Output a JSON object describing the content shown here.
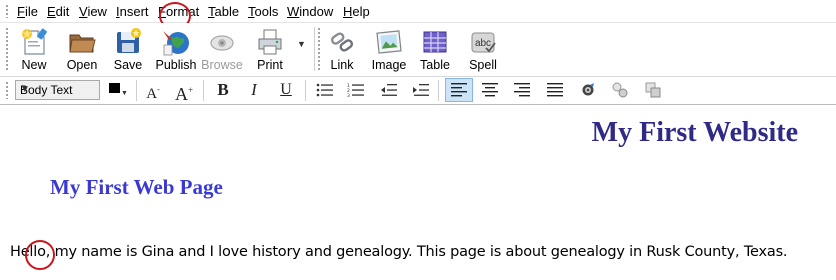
{
  "menu": {
    "items": [
      {
        "label": "File",
        "key": "F",
        "rest": "ile"
      },
      {
        "label": "Edit",
        "key": "E",
        "rest": "dit"
      },
      {
        "label": "View",
        "key": "V",
        "rest": "iew"
      },
      {
        "label": "Insert",
        "key": "I",
        "rest": "nsert"
      },
      {
        "label": "Format",
        "key": "F",
        "rest": "ormat"
      },
      {
        "label": "Table",
        "key": "T",
        "rest": "able"
      },
      {
        "label": "Tools",
        "key": "T",
        "rest": "ools"
      },
      {
        "label": "Window",
        "key": "W",
        "rest": "indow"
      },
      {
        "label": "Help",
        "key": "H",
        "rest": "elp"
      }
    ]
  },
  "toolbar": {
    "new_label": "New",
    "open_label": "Open",
    "save_label": "Save",
    "publish_label": "Publish",
    "browse_label": "Browse",
    "print_label": "Print",
    "link_label": "Link",
    "image_label": "Image",
    "table_label": "Table",
    "spell_label": "Spell"
  },
  "format": {
    "paragraph_style": "Body Text",
    "text_color": "#000000",
    "bold_glyph": "B",
    "italic_glyph": "I",
    "underline_glyph": "U",
    "active_align": "left"
  },
  "document": {
    "heading1": "My First Website",
    "heading2": "My First Web Page",
    "paragraph": "Hello, my name is Gina and I love history and genealogy. This page is about genealogy in Rusk County, Texas."
  },
  "colors": {
    "heading1": "#2f2a86",
    "heading2": "#3a3ad2",
    "annotation": "#c8171c"
  }
}
